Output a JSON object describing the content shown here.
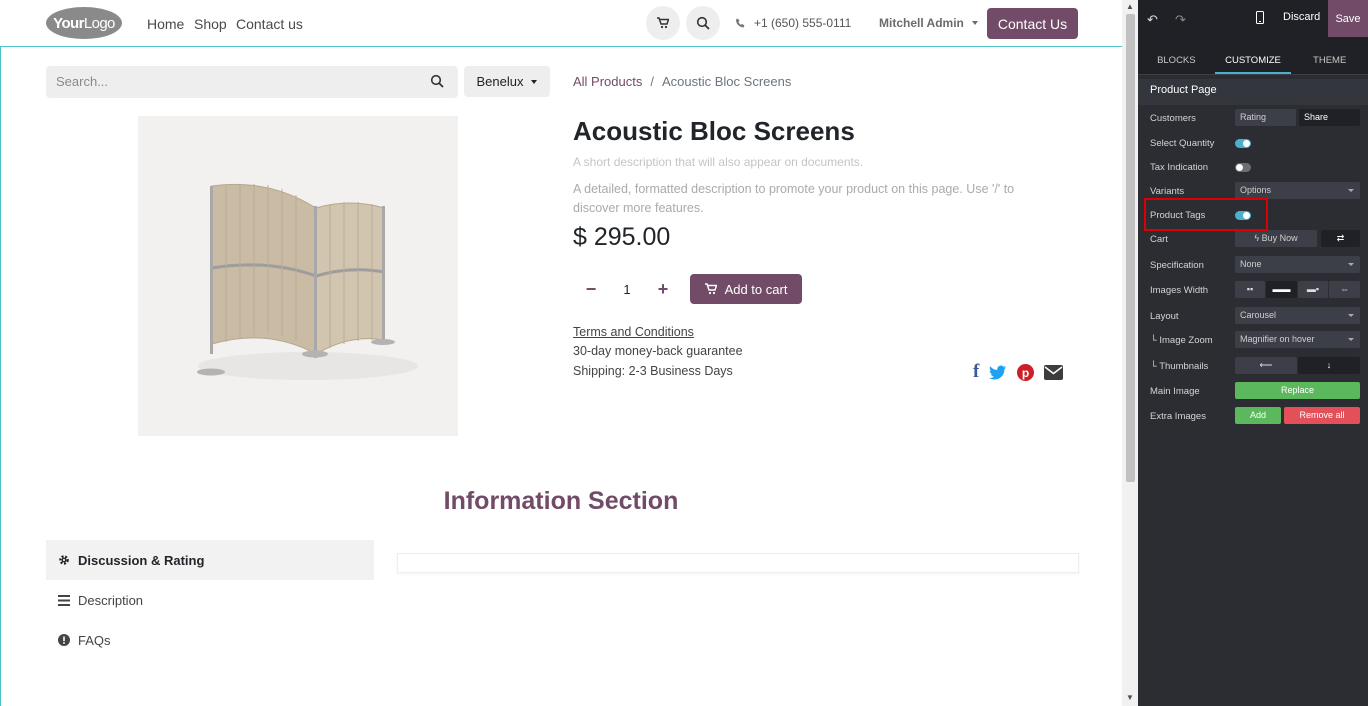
{
  "header": {
    "logo": {
      "your": "Your",
      "logo": "Logo"
    },
    "nav": [
      "Home",
      "Shop",
      "Contact us"
    ],
    "phone": "+1 (650) 555-0111",
    "user": "Mitchell Admin",
    "contact_button": "Contact Us"
  },
  "toolbar": {
    "search_placeholder": "Search...",
    "pricelist": "Benelux"
  },
  "breadcrumb": {
    "root": "All Products",
    "sep": "/",
    "current": "Acoustic Bloc Screens"
  },
  "product": {
    "name": "Acoustic Bloc Screens",
    "short_description": "A short description that will also appear on documents.",
    "long_description": "A detailed, formatted description to promote your product on this page. Use '/' to discover more features.",
    "price": "$ 295.00",
    "quantity": "1",
    "add_to_cart": "Add to cart",
    "terms": "Terms and Conditions",
    "guarantee": "30-day money-back guarantee",
    "shipping": "Shipping: 2-3 Business Days"
  },
  "info": {
    "title": "Information Section",
    "tabs": [
      "Discussion & Rating",
      "Description",
      "FAQs"
    ]
  },
  "panel": {
    "discard": "Discard",
    "save": "Save",
    "tabs": [
      "BLOCKS",
      "CUSTOMIZE",
      "THEME"
    ],
    "section": "Product Page",
    "labels": {
      "customers": "Customers",
      "select_quantity": "Select Quantity",
      "tax": "Tax Indication",
      "variants": "Variants",
      "tags": "Product Tags",
      "cart": "Cart",
      "spec": "Specification",
      "images_width": "Images Width",
      "layout": "Layout",
      "zoom": "└ Image Zoom",
      "thumbs": "└ Thumbnails",
      "main_image": "Main Image",
      "extra_images": "Extra Images"
    },
    "values": {
      "rating": "Rating",
      "share": "Share",
      "variants": "Options",
      "buy_now": "Buy Now",
      "spec": "None",
      "layout": "Carousel",
      "zoom": "Magnifier on hover",
      "replace": "Replace",
      "add": "Add",
      "remove_all": "Remove all"
    },
    "toggles": {
      "select_quantity": true,
      "tax": false,
      "tags": true
    },
    "accent": "#4cb0c9"
  },
  "colors": {
    "brand": "#714b67",
    "highlight": "#dd0000"
  }
}
